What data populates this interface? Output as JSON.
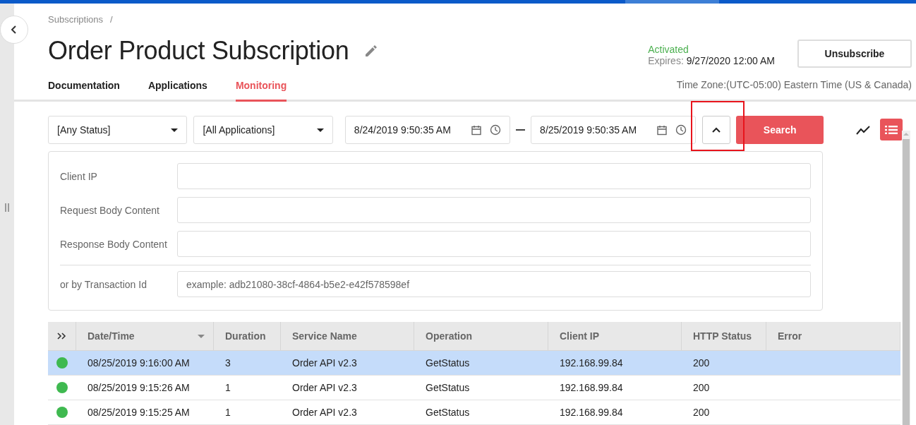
{
  "breadcrumb": {
    "items": [
      "Subscriptions"
    ],
    "separator": "/"
  },
  "title": "Order Product Subscription",
  "status": {
    "label": "Activated",
    "expires_label": "Expires:",
    "expires_value": "9/27/2020 12:00 AM"
  },
  "unsubscribe_button": "Unsubscribe",
  "tabs": [
    {
      "label": "Documentation",
      "selected": false
    },
    {
      "label": "Applications",
      "selected": false
    },
    {
      "label": "Monitoring",
      "selected": true
    }
  ],
  "time_zone": "Time Zone:(UTC-05:00) Eastern Time (US & Canada)",
  "filters": {
    "status": "[Any Status]",
    "application": "[All Applications]",
    "from": "8/24/2019 9:50:35 AM",
    "to": "8/25/2019 9:50:35 AM",
    "search_button": "Search",
    "expanded": true
  },
  "advanced": {
    "fields": [
      {
        "label": "Client IP"
      },
      {
        "label": "Request Body Content"
      },
      {
        "label": "Response Body Content"
      }
    ],
    "transaction": {
      "label": "or by Transaction Id",
      "placeholder": "example: adb21080-38cf-4864-b5e2-e42f578598ef"
    }
  },
  "view_toggle": [
    {
      "kind": "chart",
      "selected": false
    },
    {
      "kind": "list",
      "selected": true
    }
  ],
  "table": {
    "columns": [
      {
        "label": "Date/Time",
        "sorted": true
      },
      {
        "label": "Duration",
        "sorted": false
      },
      {
        "label": "Service Name",
        "sorted": false
      },
      {
        "label": "Operation",
        "sorted": false
      },
      {
        "label": "Client IP",
        "sorted": false
      },
      {
        "label": "HTTP Status",
        "sorted": false
      },
      {
        "label": "Error",
        "sorted": false
      }
    ],
    "rows": [
      {
        "selected": true,
        "color": "#3fb950",
        "cells": [
          "08/25/2019 9:16:00 AM",
          "3",
          "Order API v2.3",
          "GetStatus",
          "192.168.99.84",
          "200"
        ]
      },
      {
        "selected": false,
        "color": "#3fb950",
        "cells": [
          "08/25/2019 9:15:26 AM",
          "1",
          "Order API v2.3",
          "GetStatus",
          "192.168.99.84",
          "200"
        ]
      },
      {
        "selected": false,
        "color": "#3fb950",
        "cells": [
          "08/25/2019 9:15:25 AM",
          "1",
          "Order API v2.3",
          "GetStatus",
          "192.168.99.84",
          "200"
        ]
      }
    ]
  }
}
